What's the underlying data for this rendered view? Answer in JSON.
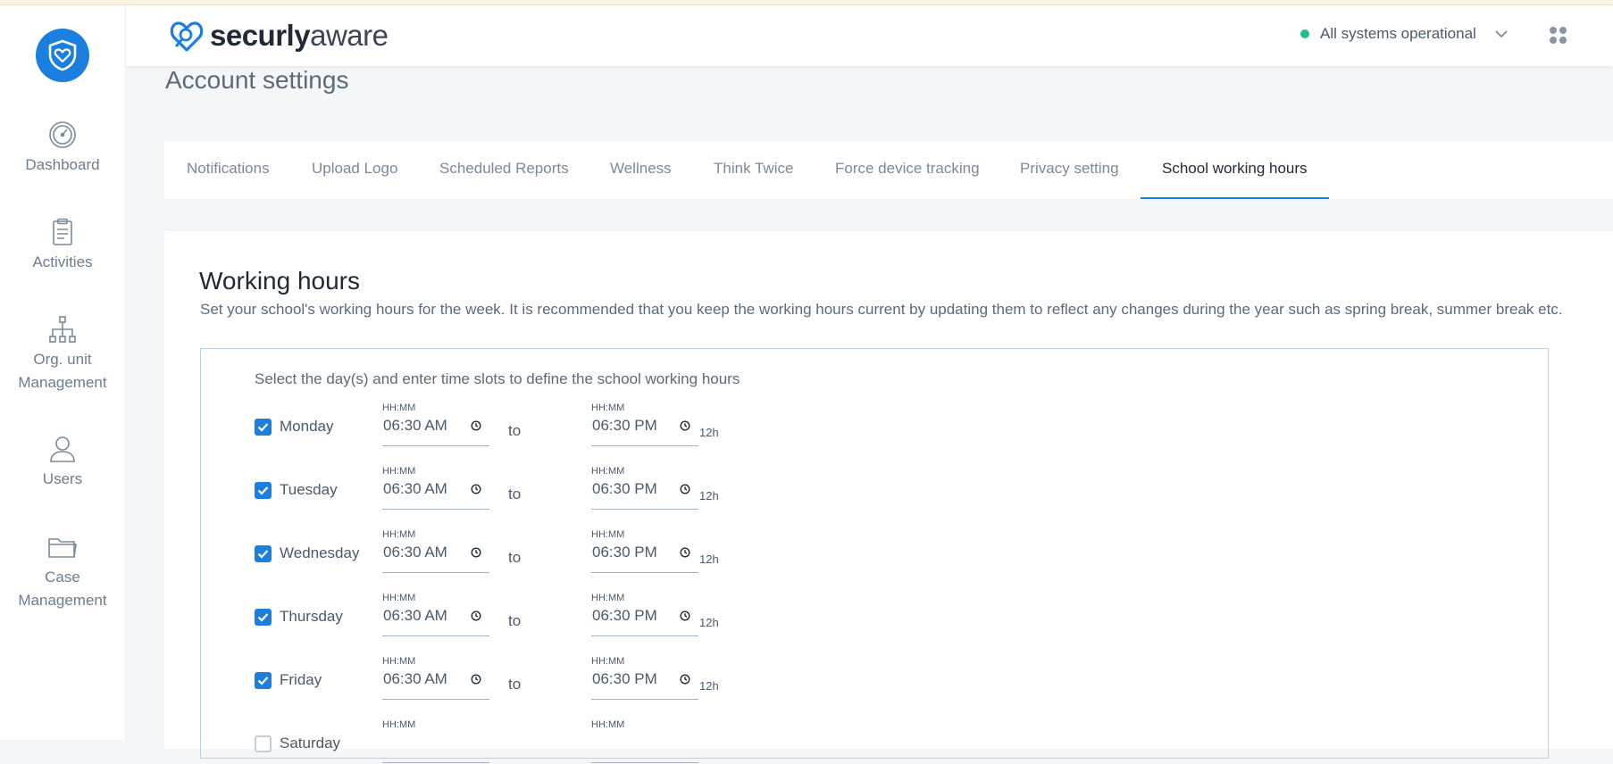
{
  "header": {
    "brand_bold": "securly",
    "brand_light": "aware",
    "status_text": "All systems operational"
  },
  "sidebar": {
    "items": [
      {
        "label": "Dashboard"
      },
      {
        "label": "Activities"
      },
      {
        "label": "Org. unit Management"
      },
      {
        "label": "Users"
      },
      {
        "label": "Case Management"
      }
    ]
  },
  "page": {
    "title": "Account settings"
  },
  "tabs": [
    {
      "label": "Notifications"
    },
    {
      "label": "Upload Logo"
    },
    {
      "label": "Scheduled Reports"
    },
    {
      "label": "Wellness"
    },
    {
      "label": "Think Twice"
    },
    {
      "label": "Force device tracking"
    },
    {
      "label": "Privacy setting"
    },
    {
      "label": "School working hours",
      "active": true
    }
  ],
  "working_hours": {
    "title": "Working hours",
    "description": "Set your school's working hours for the week. It is recommended that you keep the working hours current by updating them to reflect any changes during the year such as spring break, summer break etc.",
    "hint": "Select the day(s) and enter time slots to define the school working hours",
    "field_label": "HH:MM",
    "to_label": "to",
    "format_label": "12h",
    "days": [
      {
        "day": "Monday",
        "checked": true,
        "start": "06:30  AM",
        "end": "06:30  PM"
      },
      {
        "day": "Tuesday",
        "checked": true,
        "start": "06:30  AM",
        "end": "06:30  PM"
      },
      {
        "day": "Wednesday",
        "checked": true,
        "start": "06:30  AM",
        "end": "06:30  PM"
      },
      {
        "day": "Thursday",
        "checked": true,
        "start": "06:30  AM",
        "end": "06:30  PM"
      },
      {
        "day": "Friday",
        "checked": true,
        "start": "06:30  AM",
        "end": "06:30  PM"
      },
      {
        "day": "Saturday",
        "checked": false,
        "start": "",
        "end": ""
      }
    ]
  },
  "colors": {
    "accent": "#1b7fe0",
    "status_ok": "#1fbf8f"
  }
}
